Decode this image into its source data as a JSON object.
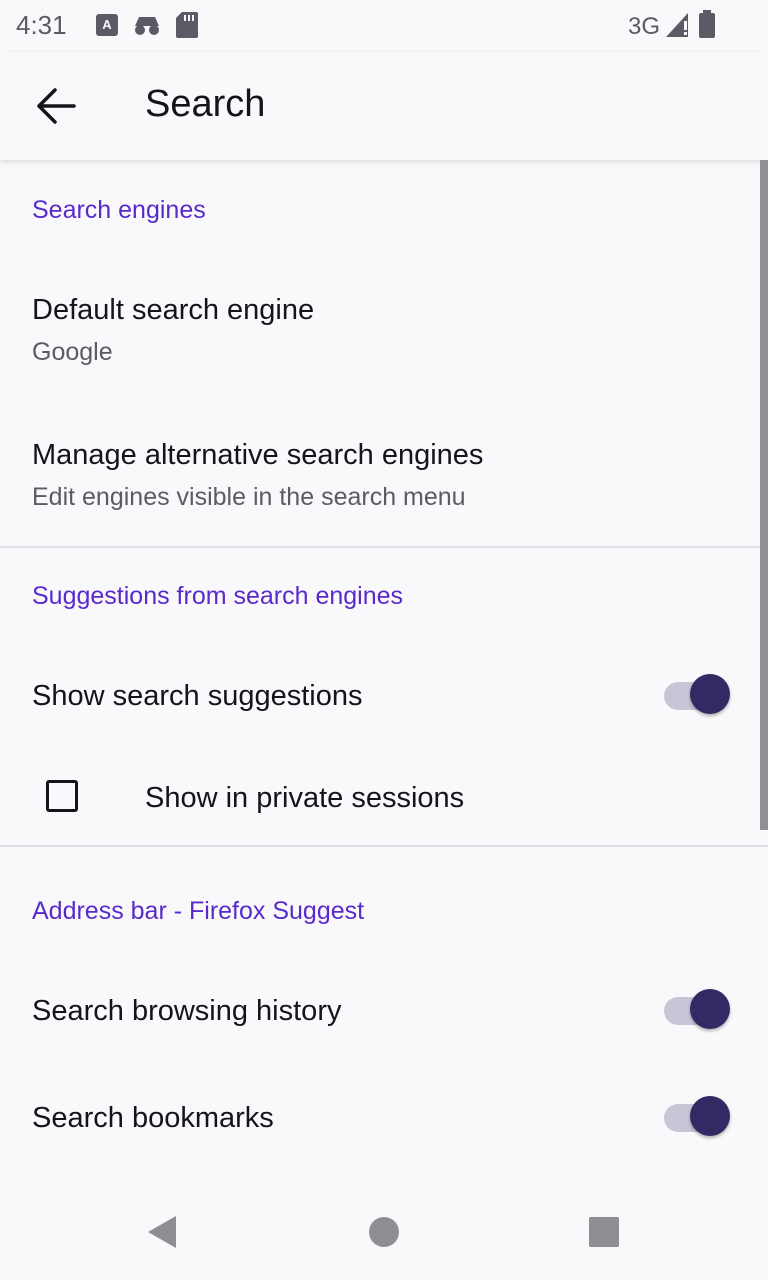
{
  "status_bar": {
    "time": "4:31",
    "network": "3G",
    "icons": [
      "keyboard-a-icon",
      "incognito-icon",
      "sd-card-icon",
      "signal-icon",
      "battery-icon"
    ]
  },
  "app_bar": {
    "title": "Search",
    "back_icon": "arrow-back-icon"
  },
  "sections": {
    "search_engines": {
      "header": "Search engines",
      "default_engine": {
        "title": "Default search engine",
        "summary": "Google"
      },
      "manage_engines": {
        "title": "Manage alternative search engines",
        "summary": "Edit engines visible in the search menu"
      }
    },
    "suggestions": {
      "header": "Suggestions from search engines",
      "show_suggestions": {
        "title": "Show search suggestions",
        "enabled": true
      },
      "private_sessions": {
        "title": "Show in private sessions",
        "checked": false
      }
    },
    "address_bar": {
      "header": "Address bar - Firefox Suggest",
      "browsing_history": {
        "title": "Search browsing history",
        "enabled": true
      },
      "bookmarks": {
        "title": "Search bookmarks",
        "enabled": true
      }
    }
  },
  "nav_bar": {
    "icons": [
      "back-triangle-icon",
      "home-circle-icon",
      "recents-square-icon"
    ]
  },
  "colors": {
    "accent": "#592acb",
    "switch_thumb": "#312a65",
    "switch_track": "#c8c6d6",
    "background": "#f9f9fb"
  }
}
